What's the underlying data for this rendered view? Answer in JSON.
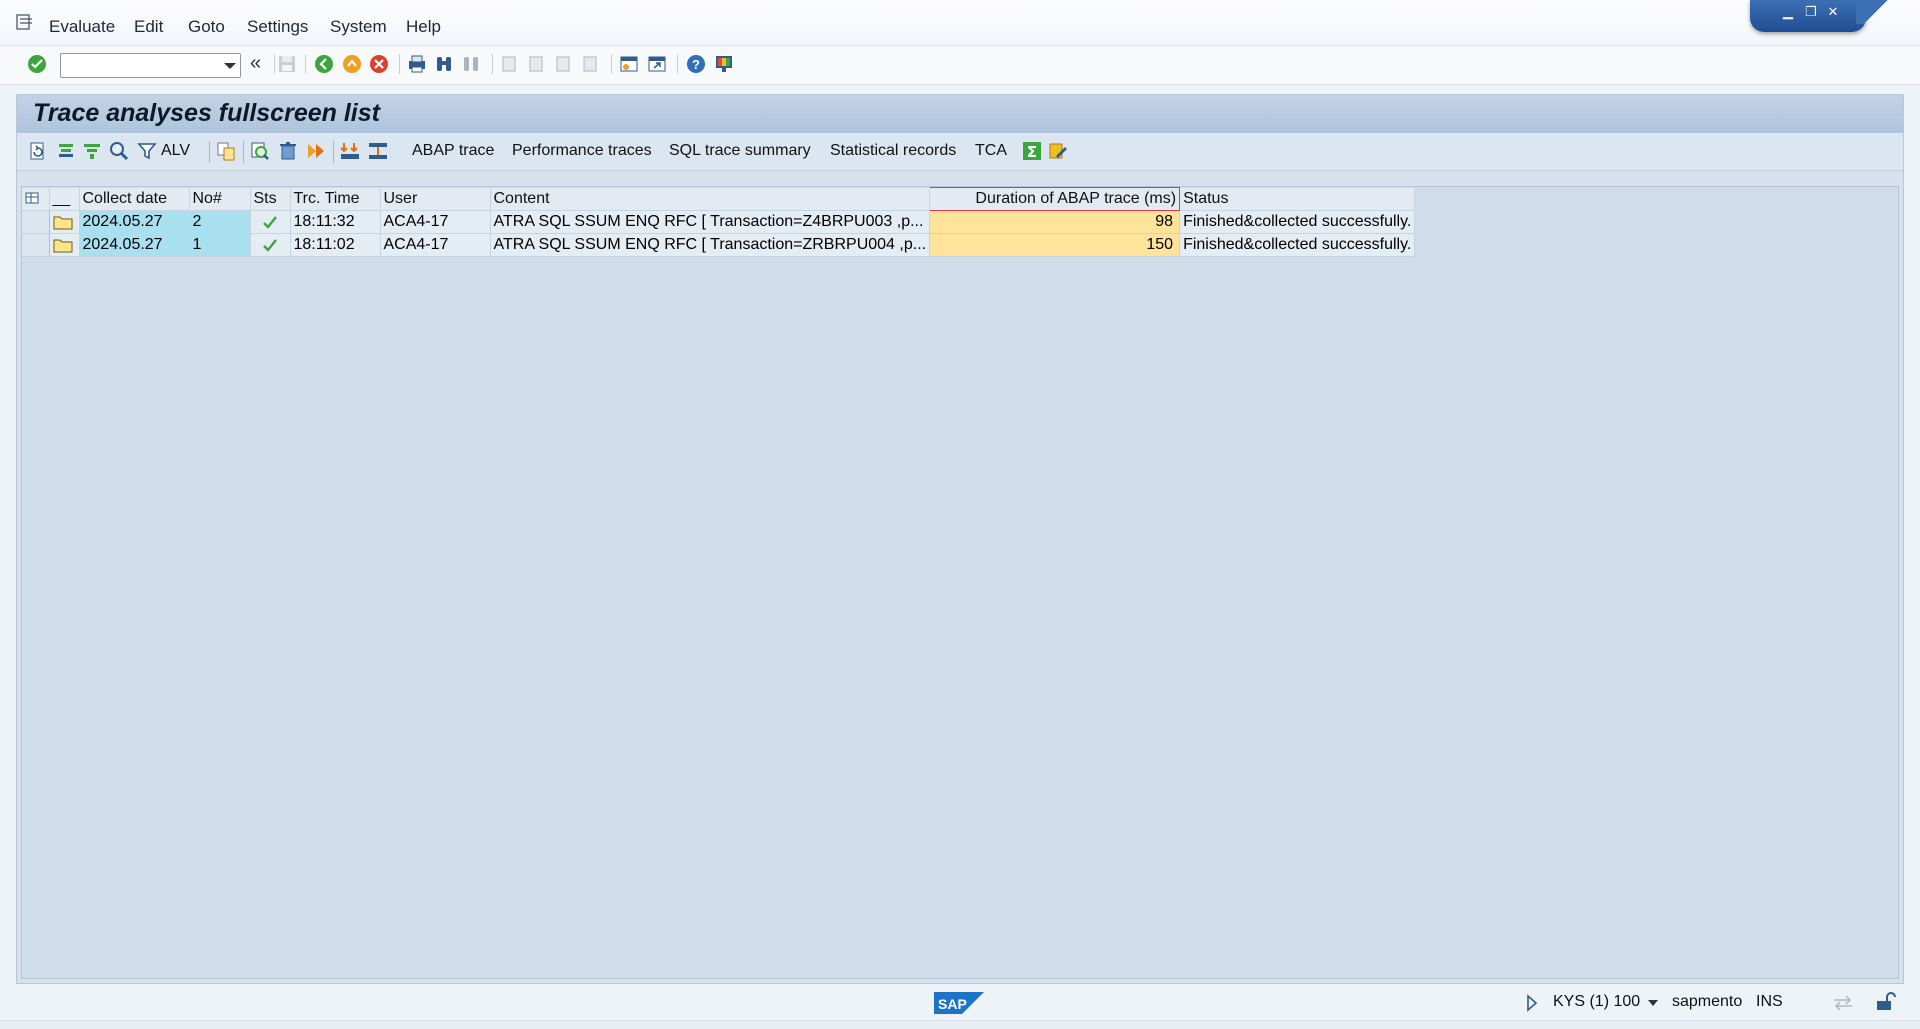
{
  "menubar": {
    "items": [
      "Evaluate",
      "Edit",
      "Goto",
      "Settings",
      "System",
      "Help"
    ]
  },
  "command_field": {
    "value": ""
  },
  "title": "Trace analyses fullscreen list",
  "app_toolbar": {
    "alv_label": "ALV",
    "buttons": [
      "ABAP trace",
      "Performance traces",
      "SQL trace summary",
      "Statistical records",
      "TCA"
    ]
  },
  "grid": {
    "columns": [
      "",
      "__",
      "Collect date",
      "No#",
      "Sts",
      "Trc. Time",
      "User",
      "Content",
      "Duration of ABAP trace (ms)",
      "Status"
    ],
    "rows": [
      {
        "collect_date": "2024.05.27",
        "no": "2",
        "sts_icon": "checkmark-icon",
        "trc_time": "18:11:32",
        "user": "ACA4-17",
        "content": "ATRA SQL SSUM ENQ RFC [ Transaction=Z4BRPU003 ,p...",
        "duration": "98",
        "status": "Finished&collected successfully."
      },
      {
        "collect_date": "2024.05.27",
        "no": "1",
        "sts_icon": "checkmark-icon",
        "trc_time": "18:11:02",
        "user": "ACA4-17",
        "content": "ATRA SQL SSUM ENQ RFC [ Transaction=ZRBRPU004 ,p...",
        "duration": "150",
        "status": "Finished&collected successfully."
      }
    ]
  },
  "statusbar": {
    "system": "KYS (1) 100",
    "server": "sapmento",
    "mode": "INS"
  },
  "colors": {
    "key_cell": "#a8e0f0",
    "duration_cell": "#fde49a",
    "panel_bg": "#d6e1ec",
    "title_bar": "#aec3dc"
  }
}
